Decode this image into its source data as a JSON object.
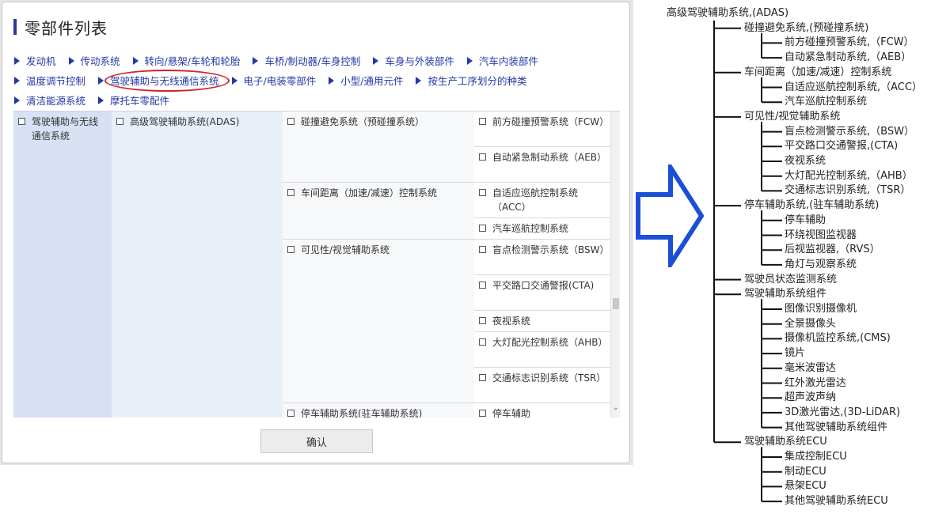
{
  "dialog": {
    "title": "零部件列表",
    "categories_row1": [
      "发动机",
      "传动系统",
      "转向/悬架/车轮和轮胎",
      "车桥/制动器/车身控制",
      "车身与外装部件",
      "汽车内装部件"
    ],
    "categories_row2": [
      "温度调节控制",
      "驾驶辅助与无线通信系统",
      "电子/电装零部件",
      "小型/通用元件",
      "按生产工序划分的种类"
    ],
    "categories_row3": [
      "清洁能源系统",
      "摩托车零配件"
    ],
    "selected_category": "驾驶辅助与无线通信系统",
    "col1": "驾驶辅助与无线通信系统",
    "col2": "高级驾驶辅助系统(ADAS)",
    "groups": [
      {
        "label": "碰撞避免系统（预碰撞系统）",
        "items": [
          "前方碰撞预警系统（FCW）",
          "自动紧急制动系统（AEB）"
        ]
      },
      {
        "label": "车间距离（加速/减速）控制系统",
        "items": [
          "自适应巡航控制系统（ACC）",
          "汽车巡航控制系统"
        ]
      },
      {
        "label": "可见性/视觉辅助系统",
        "items": [
          "盲点检测警示系统（BSW）",
          "平交路口交通警报(CTA)",
          "夜视系统",
          "大灯配光控制系统（AHB）",
          "交通标志识别系统（TSR）"
        ]
      },
      {
        "label": "停车辅助系统(驻车辅助系统)",
        "items": [
          "停车辅助",
          "环绕视图监视器",
          "后视监视器（RVS）",
          "角灯与观察系统"
        ]
      },
      {
        "label": "驾驶员状态监测系统",
        "items": []
      }
    ],
    "confirm_label": "确认"
  },
  "tree": {
    "root": "高级驾驶辅助系统,(ADAS)",
    "branches": [
      {
        "label": "碰撞避免系统,(预碰撞系统)",
        "children": [
          "前方碰撞预警系统,（FCW）",
          "自动紧急制动系统,（AEB）"
        ]
      },
      {
        "label": "车间距离（加速/减速）控制系统",
        "children": [
          "自适应巡航控制系统,（ACC）",
          "汽车巡航控制系统"
        ]
      },
      {
        "label": "可见性/视觉辅助系统",
        "children": [
          "盲点检测警示系统,（BSW）",
          "平交路口交通警报,(CTA)",
          "夜视系统",
          "大灯配光控制系统,（AHB）",
          "交通标志识别系统,（TSR）"
        ]
      },
      {
        "label": "停车辅助系统,(驻车辅助系统)",
        "children": [
          "停车辅助",
          "环绕视图监视器",
          "后视监视器,（RVS）",
          "角灯与观察系统"
        ]
      },
      {
        "label": "驾驶员状态监测系统",
        "children": []
      },
      {
        "label": "驾驶辅助系统组件",
        "children": [
          "图像识别摄像机",
          "全景摄像头",
          "摄像机监控系统,(CMS)",
          "镜片",
          "毫米波雷达",
          "红外激光雷达",
          "超声波声纳",
          "3D激光雷达,(3D-LiDAR)",
          "其他驾驶辅助系统组件"
        ]
      },
      {
        "label": "驾驶辅助系统ECU",
        "children": [
          "集成控制ECU",
          "制动ECU",
          "悬架ECU",
          "其他驾驶辅助系统ECU"
        ]
      }
    ]
  },
  "colors": {
    "link": "#2338a8",
    "highlight_ellipse": "#d0232a",
    "arrow": "#1a4fd6",
    "col1_bg": "#d7e1f3",
    "col2_bg": "#e9eff9"
  },
  "icons": {
    "category_bullet": "triangle-right-icon",
    "checkbox": "checkbox-icon",
    "arrow": "big-right-arrow-icon"
  }
}
